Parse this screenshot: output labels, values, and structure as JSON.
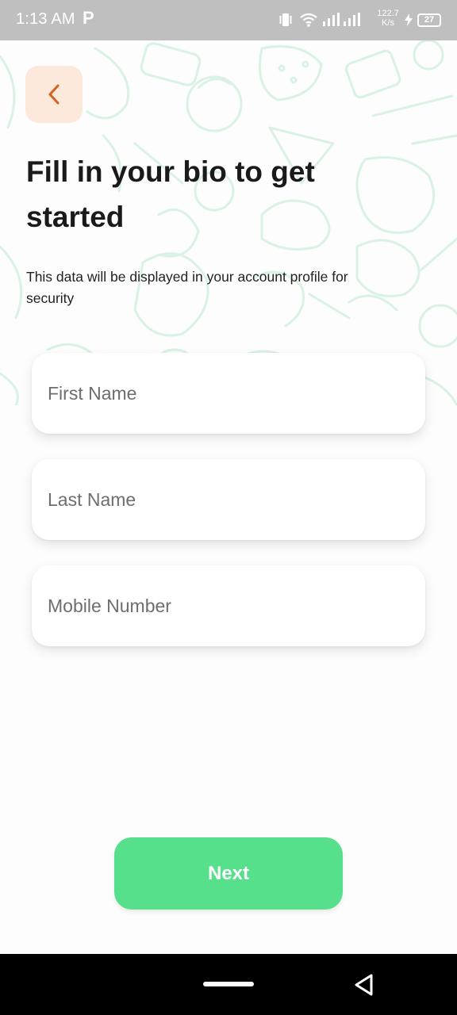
{
  "status_bar": {
    "time": "1:13 AM",
    "app_indicator": "P",
    "network_speed_value": "122.7",
    "network_speed_unit": "K/s",
    "battery_level": "27"
  },
  "header": {
    "back_icon": "chevron-left-icon"
  },
  "content": {
    "title": "Fill in your bio to get started",
    "subtitle": "This data will be displayed in your account profile for security"
  },
  "form": {
    "first_name_placeholder": "First Name",
    "last_name_placeholder": "Last Name",
    "mobile_placeholder": "Mobile Number"
  },
  "actions": {
    "next_label": "Next"
  },
  "colors": {
    "accent_green": "#57e08c",
    "back_bg": "#fde9dc",
    "back_chevron": "#d4631f",
    "doodle": "#d9f2e4"
  }
}
